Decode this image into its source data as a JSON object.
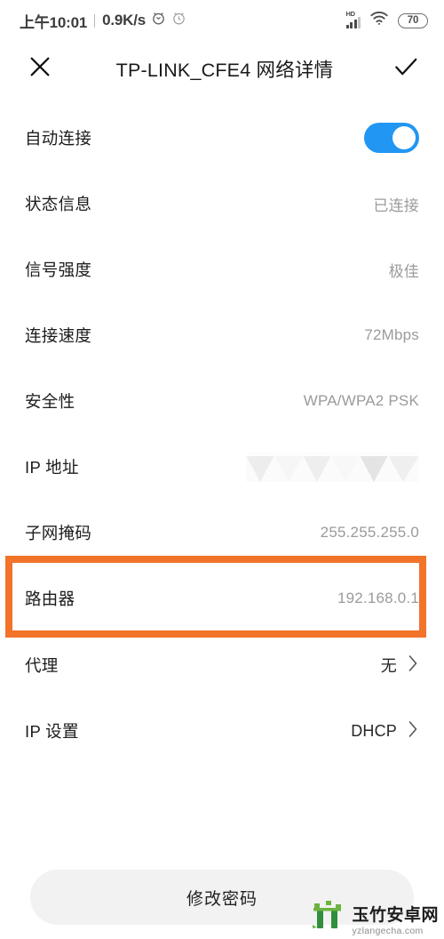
{
  "statusbar": {
    "time": "上午10:01",
    "network_speed": "0.9K/s",
    "alarm_icon_1": "alarm-clock-icon",
    "alarm_icon_2": "alarm-clock-outline-icon",
    "hd_label": "HD",
    "signal_icon": "cellular-signal-icon",
    "wifi_icon": "wifi-icon",
    "battery_level": "70"
  },
  "appbar": {
    "close_icon": "close-icon",
    "title": "TP-LINK_CFE4 网络详情",
    "confirm_icon": "check-icon"
  },
  "rows": [
    {
      "label": "自动连接",
      "type": "toggle",
      "toggle_on": true
    },
    {
      "label": "状态信息",
      "value": "已连接",
      "type": "text"
    },
    {
      "label": "信号强度",
      "value": "极佳",
      "type": "text"
    },
    {
      "label": "连接速度",
      "value": "72Mbps",
      "type": "text"
    },
    {
      "label": "安全性",
      "value": "WPA/WPA2 PSK",
      "type": "text"
    },
    {
      "label": "IP 地址",
      "value": "",
      "type": "redacted"
    },
    {
      "label": "子网掩码",
      "value": "255.255.255.0",
      "type": "text"
    },
    {
      "label": "路由器",
      "value": "192.168.0.1",
      "type": "text",
      "highlighted": true
    }
  ],
  "rows2": [
    {
      "label": "代理",
      "value": "无",
      "type": "chevron"
    },
    {
      "label": "IP 设置",
      "value": "DHCP",
      "type": "chevron"
    }
  ],
  "bottom": {
    "change_password_label": "修改密码"
  },
  "watermark": {
    "name": "玉竹安卓网",
    "url": "yzlangecha.com"
  },
  "colors": {
    "accent_blue": "#2196f3",
    "highlight_orange": "#f2732a",
    "label_text": "#1c1c1c",
    "value_text": "#9b9b9b",
    "button_bg": "#f2f2f2"
  }
}
